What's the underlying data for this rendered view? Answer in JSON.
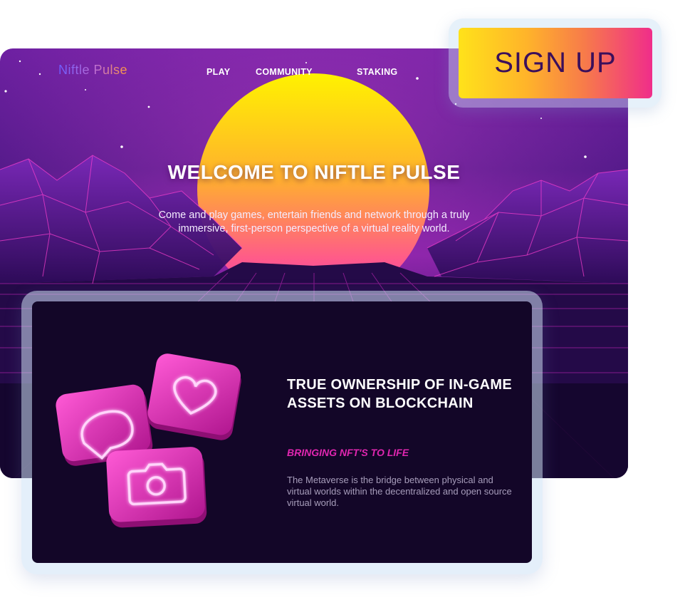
{
  "brand": {
    "name": "Niftle Pulse"
  },
  "nav": {
    "items": [
      "PLAY",
      "COMMUNITY",
      "STAKING"
    ]
  },
  "hero": {
    "title": "WELCOME TO NIFTLE PULSE",
    "subtitle": "Come and play games, entertain friends and network through a truly immersive, first-person perspective of a virtual reality world."
  },
  "signup": {
    "label": "SIGN UP"
  },
  "feature": {
    "title": "TRUE OWNERSHIP OF IN-GAME ASSETS ON BLOCKCHAIN",
    "tagline": "BRINGING NFT'S TO LIFE",
    "description": "The Metaverse is the bridge between physical and\nvirtual worlds within the decentralized and open source\nvirtual world.",
    "icons": [
      "chat-bubble-icon",
      "heart-icon",
      "camera-icon"
    ]
  },
  "colors": {
    "accent_pink": "#e026b0",
    "signup_text": "#3b0f5b",
    "card_bg": "#130628"
  }
}
